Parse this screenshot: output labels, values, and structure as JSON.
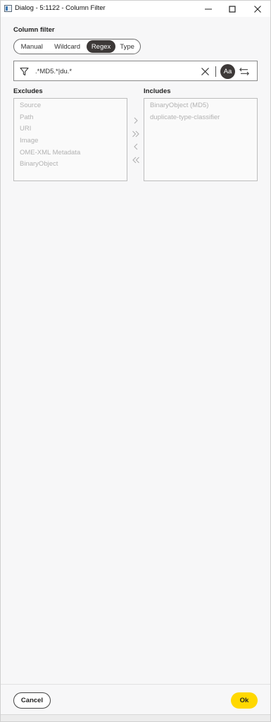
{
  "window": {
    "title": "Dialog - 5:1122 - Column Filter"
  },
  "filter_panel": {
    "section_label": "Column filter",
    "modes": [
      {
        "label": "Manual",
        "active": false
      },
      {
        "label": "Wildcard",
        "active": false
      },
      {
        "label": "Regex",
        "active": true
      },
      {
        "label": "Type",
        "active": false
      }
    ],
    "pattern_value": ".*MD5.*|du.*",
    "case_sensitive_label": "Aa"
  },
  "excludes": {
    "label": "Excludes",
    "items": [
      "Source",
      "Path",
      "URI",
      "Image",
      "OME-XML Metadata",
      "BinaryObject"
    ]
  },
  "includes": {
    "label": "Includes",
    "items": [
      "BinaryObject (MD5)",
      "duplicate-type-classifier"
    ]
  },
  "transfer_buttons": {
    "add": "›",
    "add_all": "»",
    "remove": "‹",
    "remove_all": "«"
  },
  "footer": {
    "cancel_label": "Cancel",
    "ok_label": "Ok"
  },
  "colors": {
    "accent_dark": "#3d3938",
    "ok_yellow": "#ffd800",
    "disabled_text": "#b2b2b2"
  }
}
